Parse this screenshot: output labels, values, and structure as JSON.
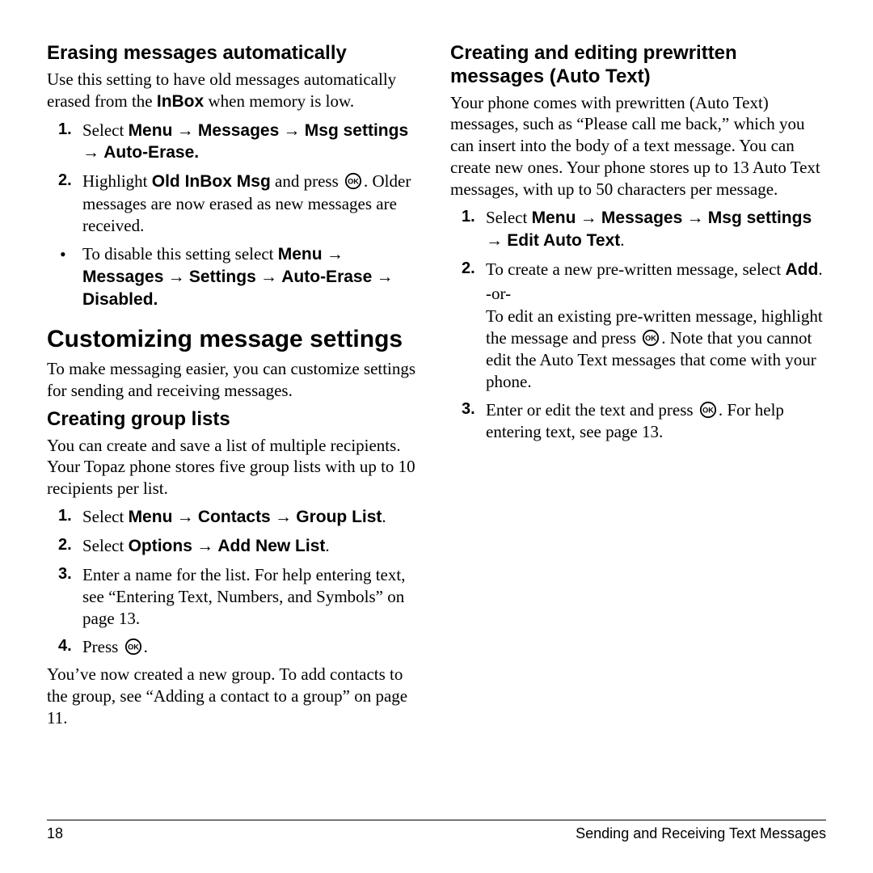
{
  "footer": {
    "page_num": "18",
    "chapter": "Sending and Receiving Text Messages"
  },
  "left": {
    "erase_h": "Erasing messages automatically",
    "erase_p": "Use this setting to have old messages automatically erased from the ",
    "erase_p_inbox": "InBox",
    "erase_p_tail": " when memory is low.",
    "erase_step1_a": "Select ",
    "erase_step1_menu": "Menu",
    "erase_step1_messages": "Messages",
    "erase_step1_msgset": "Msg settings",
    "erase_step1_auto": "Auto-Erase",
    "erase_step2_a": "Highlight ",
    "erase_step2_old": "Old InBox Msg",
    "erase_step2_b": " and press ",
    "erase_step2_c": ". Older messages are now erased as new messages are received.",
    "erase_bullet_a": "To disable this setting select ",
    "erase_bullet_menu": "Menu",
    "erase_bullet_messages": "Messages",
    "erase_bullet_settings": "Settings",
    "erase_bullet_auto": "Auto-Erase",
    "erase_bullet_disabled": "Disabled",
    "custom_h": "Customizing message settings",
    "custom_p": "To make messaging easier, you can customize settings for sending and receiving messages.",
    "group_h": "Creating group lists",
    "group_p": "You can create and save a list of multiple recipients. Your Topaz phone stores five group lists with up to 10 recipients per list.",
    "group_s1_a": "Select ",
    "group_s1_menu": "Menu",
    "group_s1_contacts": "Contacts",
    "group_s1_glist": "Group List",
    "group_s2_a": "Select ",
    "group_s2_options": "Options",
    "group_s2_add": "Add New List",
    "group_s3": "Enter a name for the list. For help entering text, see “Entering Text, Numbers, and Symbols” on page 13.",
    "group_s4": "Press ",
    "group_after": "You’ve now created a new group. To add contacts to the group, see “Adding a contact to a group” on page 11."
  },
  "right": {
    "auto_h": "Creating and editing prewritten messages (Auto Text)",
    "auto_p": "Your phone comes with prewritten (Auto Text) messages, such as “Please call me back,” which you can insert into the body of a text message. You can create new ones. Your phone stores up to 13 Auto Text messages, with up to 50 characters per message.",
    "auto_s1_a": "Select ",
    "auto_s1_menu": "Menu",
    "auto_s1_messages": "Messages",
    "auto_s1_msgset": "Msg settings",
    "auto_s1_edit": "Edit Auto Text",
    "auto_s2_a": "To create a new pre-written message, select ",
    "auto_s2_add": "Add",
    "auto_s2_or": "-or-",
    "auto_s2_b": "To edit an existing pre-written message, highlight the message and press ",
    "auto_s2_c": ". Note that you cannot edit the Auto Text messages that come with your phone.",
    "auto_s3_a": "Enter or edit the text and press ",
    "auto_s3_b": ". For help entering text, see page 13."
  },
  "glyphs": {
    "arrow": " → ",
    "period": "."
  }
}
